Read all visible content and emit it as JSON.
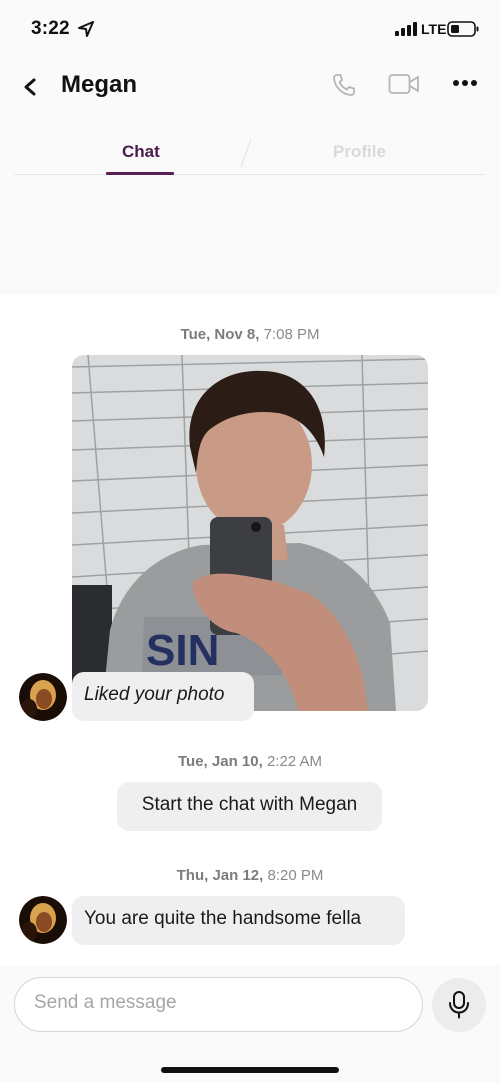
{
  "status_bar": {
    "time": "3:22",
    "network": "LTE"
  },
  "header": {
    "contact_name": "Megan"
  },
  "tabs": [
    {
      "label": "Chat",
      "active": true
    },
    {
      "label": "Profile",
      "active": false
    }
  ],
  "messages": [
    {
      "date": "Tue, Nov 8,",
      "time": "7:08 PM"
    },
    {
      "reaction_text": "Liked your photo"
    },
    {
      "date": "Tue, Jan 10,",
      "time": "2:22 AM"
    },
    {
      "prompt_text": "Start the chat with Megan"
    },
    {
      "date": "Thu, Jan 12,",
      "time": "8:20 PM"
    },
    {
      "text": "You are quite the handsome fella"
    }
  ],
  "composer": {
    "placeholder": "Send a message"
  },
  "colors": {
    "accent": "#5b1e57",
    "bubble": "#f0efef",
    "muted_text": "#8a8a8a"
  }
}
